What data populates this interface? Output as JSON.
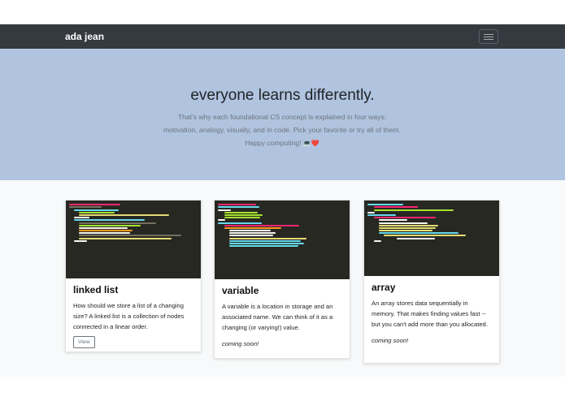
{
  "nav": {
    "brand": "ada jean"
  },
  "hero": {
    "title": "everyone learns differently.",
    "lead": "That's why each foundational CS concept is explained in four ways: motivation, analogy, visually, and in code. Pick your favorite or try all of them. Happy computing!",
    "icons": "💻❤️"
  },
  "cards": [
    {
      "title": "linked list",
      "text": "How should we store a list of a changing size? A linked list is a collection of nodes connected in a linear order.",
      "button": "View",
      "image": "code-screenshot"
    },
    {
      "title": "variable",
      "text": "A variable is a location in storage and an associated name. We can think of it as a changing (or varying!) value.",
      "note": "coming soon!",
      "image": "code-screenshot"
    },
    {
      "title": "array",
      "text": "An array stores data sequentially in memory. That makes finding values fast -- but you can't add more than you allocated.",
      "note": "coming soon!",
      "image": "code-screenshot"
    }
  ],
  "colors": {
    "navbar": "#343a40",
    "hero": "#b0c3df",
    "code_bg": "#272822",
    "album": "#f8f9fa"
  }
}
